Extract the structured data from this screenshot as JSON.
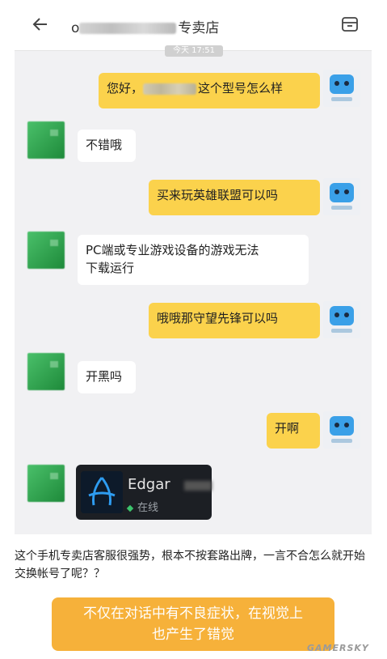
{
  "header": {
    "title_prefix": "o",
    "title_suffix": "专卖店"
  },
  "timestamp": "今天 17:51",
  "messages": {
    "m1": "您好，",
    "m1b": "这个型号怎么样",
    "m2": "不错哦",
    "m3": "买来玩英雄联盟可以吗",
    "m4a": "PC端或专业游戏设备的游戏无法",
    "m4b": "下载运行",
    "m5": "哦哦那守望先锋可以吗",
    "m6": "开黑吗",
    "m7": "开啊"
  },
  "contact_card": {
    "name": "Edgar",
    "status": "在线"
  },
  "caption": "这个手机专卖店客服很强势，根本不按套路出牌，一言不合怎么就开始交换帐号了呢？？",
  "highlight": {
    "line1": "不仅在对话中有不良症状，在视觉上",
    "line2": "也产生了错觉"
  },
  "watermark": "GAMERSKY",
  "colors": {
    "my_bubble": "#fbd24c",
    "their_bubble": "#ffffff",
    "highlight": "#f6b13a"
  }
}
